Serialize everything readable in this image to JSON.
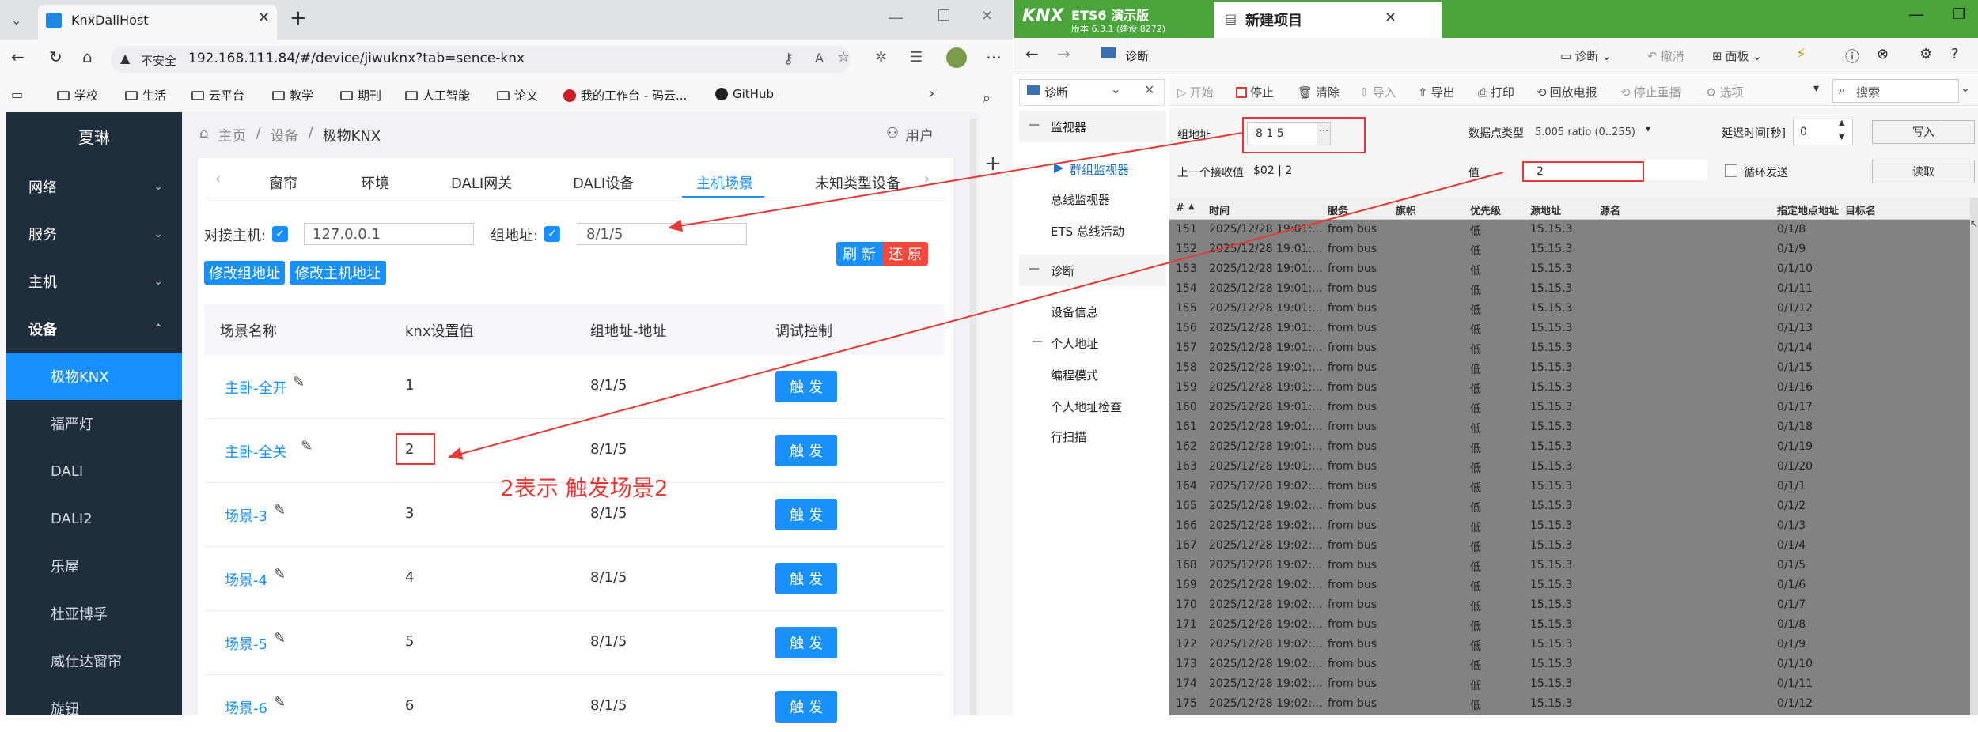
{
  "browser": {
    "tab_title": "KnxDaliHost",
    "url_warning": "不安全",
    "url": "192.168.111.84/#/device/jiwuknx?tab=sence-knx",
    "bookmarks": [
      "学校",
      "生活",
      "云平台",
      "教学",
      "期刊",
      "人工智能",
      "论文",
      "我的工作台 - 码云...",
      "GitHub"
    ]
  },
  "app": {
    "brand": "夏琳",
    "sidebar": [
      {
        "label": "网络"
      },
      {
        "label": "服务"
      },
      {
        "label": "主机"
      },
      {
        "label": "设备"
      }
    ],
    "subitems": [
      "极物KNX",
      "福严灯",
      "DALI",
      "DALI2",
      "乐屋",
      "杜亚博孚",
      "威仕达窗帘",
      "旋钮"
    ],
    "breadcrumb": [
      "主页",
      "设备",
      "极物KNX"
    ],
    "user": "用户",
    "tabs": [
      "窗帘",
      "环境",
      "DALI网关",
      "DALI设备",
      "主机场景",
      "未知类型设备"
    ],
    "form": {
      "host_label": "对接主机:",
      "host_value": "127.0.0.1",
      "group_label": "组地址:",
      "group_value": "8/1/5",
      "btn_mod_group": "修改组地址",
      "btn_mod_host": "修改主机地址",
      "btn_refresh": "刷 新",
      "btn_restore": "还 原"
    },
    "table": {
      "headers": [
        "场景名称",
        "knx设置值",
        "组地址-地址",
        "调试控制"
      ],
      "rows": [
        {
          "name": "主卧-全开",
          "value": "1",
          "addr": "8/1/5",
          "action": "触 发"
        },
        {
          "name": "主卧-全关",
          "value": "2",
          "addr": "8/1/5",
          "action": "触 发"
        },
        {
          "name": "场景-3",
          "value": "3",
          "addr": "8/1/5",
          "action": "触 发"
        },
        {
          "name": "场景-4",
          "value": "4",
          "addr": "8/1/5",
          "action": "触 发"
        },
        {
          "name": "场景-5",
          "value": "5",
          "addr": "8/1/5",
          "action": "触 发"
        },
        {
          "name": "场景-6",
          "value": "6",
          "addr": "8/1/5",
          "action": "触 发"
        }
      ]
    },
    "annotation": "2表示 触发场景2"
  },
  "ets": {
    "logo": "KNX",
    "title": "ETS6 演示版",
    "version": "版本 6.3.1 (建设 8272)",
    "project_tab": "新建项目",
    "crumb": "诊断",
    "toolbar_right": [
      "诊断",
      "撤消",
      "面板"
    ],
    "left_dropdown": "诊断",
    "left_tree": {
      "monitor": "监视器",
      "group_monitor": "群组监视器",
      "bus_monitor": "总线监视器",
      "bus_activity": "ETS 总线活动",
      "diag": "诊断",
      "device_info": "设备信息",
      "individual": "个人地址",
      "prog_mode": "编程模式",
      "ind_check": "个人地址检查",
      "line_scan": "行扫描"
    },
    "actions": [
      "开始",
      "停止",
      "清除",
      "导入",
      "导出",
      "打印",
      "回放电报",
      "停止重播",
      "选项"
    ],
    "search_placeholder": "搜索",
    "fields": {
      "group_label": "组地址",
      "group_value": "8 1 5",
      "dpt_label": "数据点类型",
      "dpt_value": "5.005 ratio (0..255)",
      "delay_label": "延迟时间[秒]",
      "delay_value": "0",
      "write": "写入",
      "read": "读取",
      "last_label": "上一个接收值",
      "last_value": "$02 | 2",
      "value_label": "值",
      "value_value": "2",
      "loop_label": "循环发送"
    },
    "columns": [
      "#",
      "时间",
      "服务",
      "旗帜",
      "优先级",
      "源地址",
      "源名",
      "指定地点地址",
      "目标名"
    ],
    "rows": [
      [
        "151",
        "2025/12/28 19:01:...",
        "from bus",
        "低",
        "15.15.3",
        "0/1/8"
      ],
      [
        "152",
        "2025/12/28 19:01:...",
        "from bus",
        "低",
        "15.15.3",
        "0/1/9"
      ],
      [
        "153",
        "2025/12/28 19:01:...",
        "from bus",
        "低",
        "15.15.3",
        "0/1/10"
      ],
      [
        "154",
        "2025/12/28 19:01:...",
        "from bus",
        "低",
        "15.15.3",
        "0/1/11"
      ],
      [
        "155",
        "2025/12/28 19:01:...",
        "from bus",
        "低",
        "15.15.3",
        "0/1/12"
      ],
      [
        "156",
        "2025/12/28 19:01:...",
        "from bus",
        "低",
        "15.15.3",
        "0/1/13"
      ],
      [
        "157",
        "2025/12/28 19:01:...",
        "from bus",
        "低",
        "15.15.3",
        "0/1/14"
      ],
      [
        "158",
        "2025/12/28 19:01:...",
        "from bus",
        "低",
        "15.15.3",
        "0/1/15"
      ],
      [
        "159",
        "2025/12/28 19:01:...",
        "from bus",
        "低",
        "15.15.3",
        "0/1/16"
      ],
      [
        "160",
        "2025/12/28 19:01:...",
        "from bus",
        "低",
        "15.15.3",
        "0/1/17"
      ],
      [
        "161",
        "2025/12/28 19:01:...",
        "from bus",
        "低",
        "15.15.3",
        "0/1/18"
      ],
      [
        "162",
        "2025/12/28 19:01:...",
        "from bus",
        "低",
        "15.15.3",
        "0/1/19"
      ],
      [
        "163",
        "2025/12/28 19:01:...",
        "from bus",
        "低",
        "15.15.3",
        "0/1/20"
      ],
      [
        "164",
        "2025/12/28 19:02:...",
        "from bus",
        "低",
        "15.15.3",
        "0/1/1"
      ],
      [
        "165",
        "2025/12/28 19:02:...",
        "from bus",
        "低",
        "15.15.3",
        "0/1/2"
      ],
      [
        "166",
        "2025/12/28 19:02:...",
        "from bus",
        "低",
        "15.15.3",
        "0/1/3"
      ],
      [
        "167",
        "2025/12/28 19:02:...",
        "from bus",
        "低",
        "15.15.3",
        "0/1/4"
      ],
      [
        "168",
        "2025/12/28 19:02:...",
        "from bus",
        "低",
        "15.15.3",
        "0/1/5"
      ],
      [
        "169",
        "2025/12/28 19:02:...",
        "from bus",
        "低",
        "15.15.3",
        "0/1/6"
      ],
      [
        "170",
        "2025/12/28 19:02:...",
        "from bus",
        "低",
        "15.15.3",
        "0/1/7"
      ],
      [
        "171",
        "2025/12/28 19:02:...",
        "from bus",
        "低",
        "15.15.3",
        "0/1/8"
      ],
      [
        "172",
        "2025/12/28 19:02:...",
        "from bus",
        "低",
        "15.15.3",
        "0/1/9"
      ],
      [
        "173",
        "2025/12/28 19:02:...",
        "from bus",
        "低",
        "15.15.3",
        "0/1/10"
      ],
      [
        "174",
        "2025/12/28 19:02:...",
        "from bus",
        "低",
        "15.15.3",
        "0/1/11"
      ],
      [
        "175",
        "2025/12/28 19:02:...",
        "from bus",
        "低",
        "15.15.3",
        "0/1/12"
      ]
    ]
  }
}
